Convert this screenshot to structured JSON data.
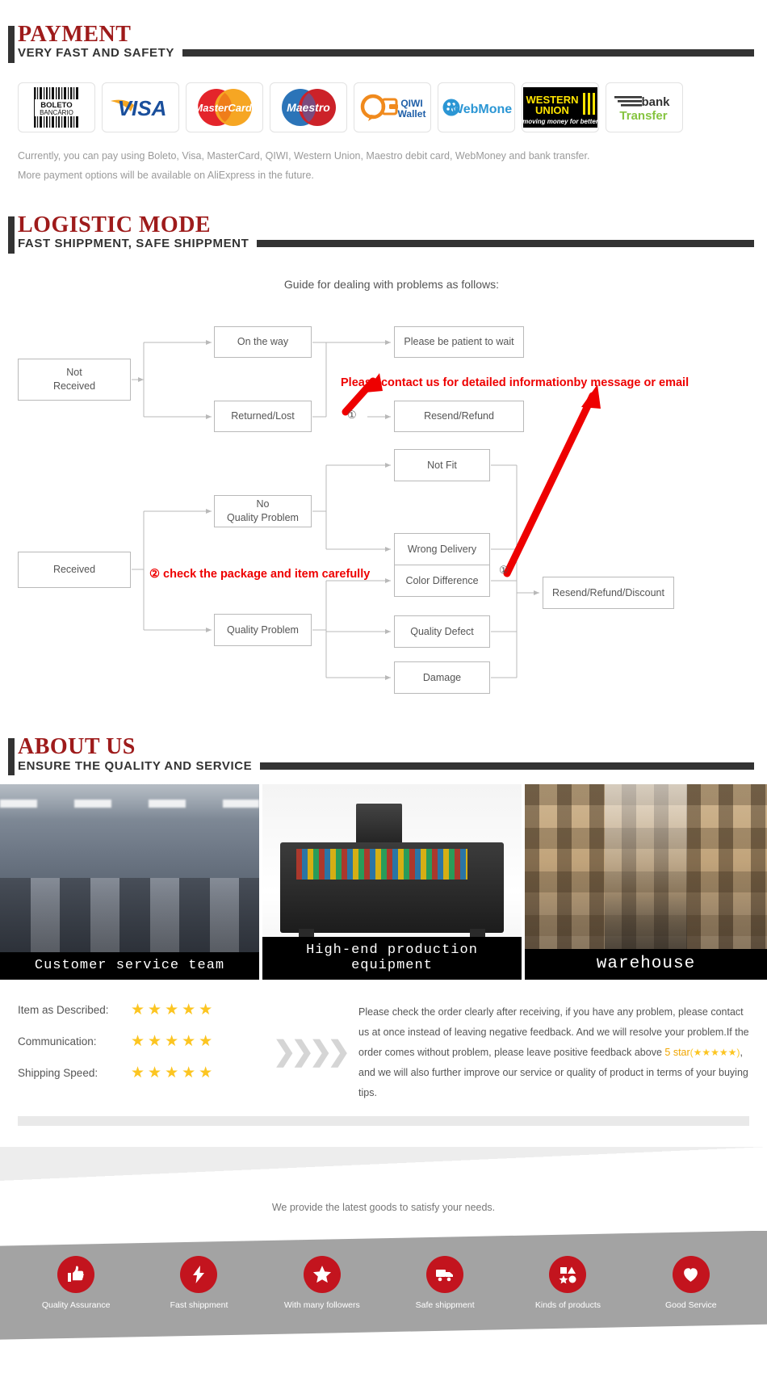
{
  "payment": {
    "title": "PAYMENT",
    "subtitle": "VERY FAST AND SAFETY",
    "logos": [
      {
        "name": "boleto-bancario-logo",
        "label": "BOLETO BANCÁRIO"
      },
      {
        "name": "visa-logo",
        "label": "VISA"
      },
      {
        "name": "mastercard-logo",
        "label": "MasterCard"
      },
      {
        "name": "maestro-logo",
        "label": "Maestro"
      },
      {
        "name": "qiwi-wallet-logo",
        "label": "QIWI Wallet"
      },
      {
        "name": "webmoney-logo",
        "label": "WebMoney"
      },
      {
        "name": "western-union-logo",
        "label": "WESTERN UNION moving money for better"
      },
      {
        "name": "bank-transfer-logo",
        "label": "bank transfer"
      }
    ],
    "note_line1": "Currently, you can pay using Boleto, Visa, MasterCard, QIWI, Western Union, Maestro debit card, WebMoney and bank transfer.",
    "note_line2": "More payment options will be available on AliExpress in the future."
  },
  "logistic": {
    "title": "LOGISTIC MODE",
    "subtitle": "FAST SHIPPMENT, SAFE SHIPPMENT",
    "guide_title": "Guide for dealing with problems as follows:",
    "boxes": {
      "not_received": "Not\nReceived",
      "on_the_way": "On the way",
      "returned_lost": "Returned/Lost",
      "please_wait": "Please be patient to wait",
      "resend_refund": "Resend/Refund",
      "received": "Received",
      "no_quality_problem": "No\nQuality Problem",
      "quality_problem": "Quality Problem",
      "not_fit": "Not Fit",
      "wrong_delivery": "Wrong Delivery",
      "color_difference": "Color Difference",
      "quality_defect": "Quality Defect",
      "damage": "Damage",
      "resend_refund_discount": "Resend/Refund/Discount"
    },
    "notes": {
      "note1": "Please contact us for detailed informationby message or email",
      "note2": "② check the package and item carefully",
      "marker_a": "①",
      "marker_b": "①"
    }
  },
  "about": {
    "title": "ABOUT US",
    "subtitle": "ENSURE THE QUALITY AND SERVICE",
    "photos": [
      {
        "name": "photo-customer-service-team",
        "caption": "Customer service team"
      },
      {
        "name": "photo-production-equipment",
        "caption": "High-end production equipment"
      },
      {
        "name": "photo-warehouse",
        "caption": "warehouse"
      }
    ]
  },
  "feedback": {
    "ratings": [
      {
        "label": "Item as Described:",
        "stars": "★★★★★",
        "value": 5
      },
      {
        "label": "Communication:",
        "stars": "★★★★★",
        "value": 5
      },
      {
        "label": "Shipping Speed:",
        "stars": "★★★★★",
        "value": 5
      }
    ],
    "chevrons": "❯❯❯❯",
    "text_part1": "Please check the order clearly after receiving, if you have any problem, please contact us at once instead of leaving negative feedback. And we will resolve your problem.If the order comes without problem, please leave positive feedback above ",
    "text_highlight": "5 star",
    "text_stars": "(★★★★★)",
    "text_part2": ", and we will also further improve our service or quality of product in terms of your buying tips."
  },
  "footer": {
    "tagline": "We provide the latest goods to satisfy your needs.",
    "items": [
      {
        "icon": "thumbs-up-icon",
        "label": "Quality Assurance"
      },
      {
        "icon": "lightning-bolt-icon",
        "label": "Fast shippment"
      },
      {
        "icon": "star-icon",
        "label": "With many followers"
      },
      {
        "icon": "truck-icon",
        "label": "Safe shippment"
      },
      {
        "icon": "shapes-icon",
        "label": "Kinds of products"
      },
      {
        "icon": "heart-icon",
        "label": "Good Service"
      }
    ]
  },
  "colors": {
    "accent_red": "#9e1b1b",
    "note_red": "#ee0000",
    "badge_red": "#c3141e",
    "star_yellow": "#fcc521",
    "band_grey": "#a3a3a3",
    "dark_bar": "#333333"
  }
}
